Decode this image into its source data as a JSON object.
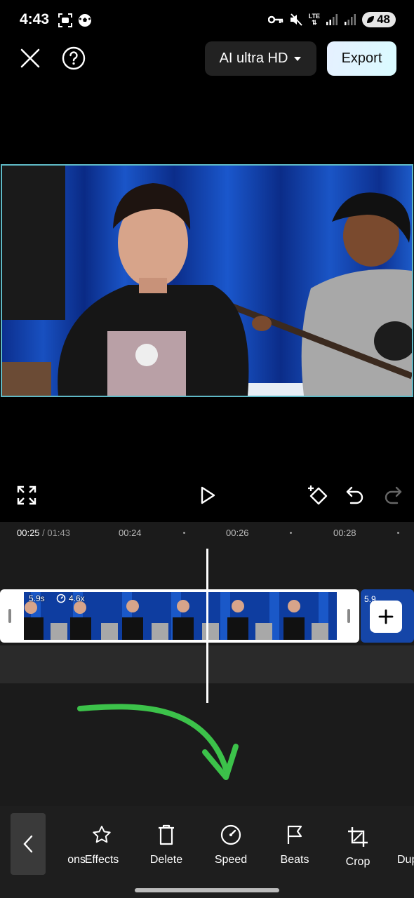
{
  "status_bar": {
    "time": "4:43",
    "network": "LTE",
    "battery": "48"
  },
  "top_bar": {
    "quality_label": "AI ultra HD",
    "export_label": "Export"
  },
  "timeline": {
    "current_time": "00:25",
    "total_time": "/ 01:43",
    "ticks": [
      "00:24",
      "00:26",
      "00:28"
    ],
    "clip": {
      "duration": "5.9s",
      "speed": "4.6x"
    },
    "next_clip_label": "5.9"
  },
  "toolbar": {
    "items": [
      {
        "label": "ons",
        "icon": "partial-icon"
      },
      {
        "label": "Effects",
        "icon": "star-icon"
      },
      {
        "label": "Delete",
        "icon": "trash-icon"
      },
      {
        "label": "Speed",
        "icon": "speedometer-icon"
      },
      {
        "label": "Beats",
        "icon": "flag-icon"
      },
      {
        "label": "Crop",
        "icon": "crop-icon"
      },
      {
        "label": "Dup",
        "icon": "duplicate-icon"
      }
    ]
  },
  "colors": {
    "accent_border": "#5fb9c6",
    "annotation_arrow": "#3cc24a"
  }
}
